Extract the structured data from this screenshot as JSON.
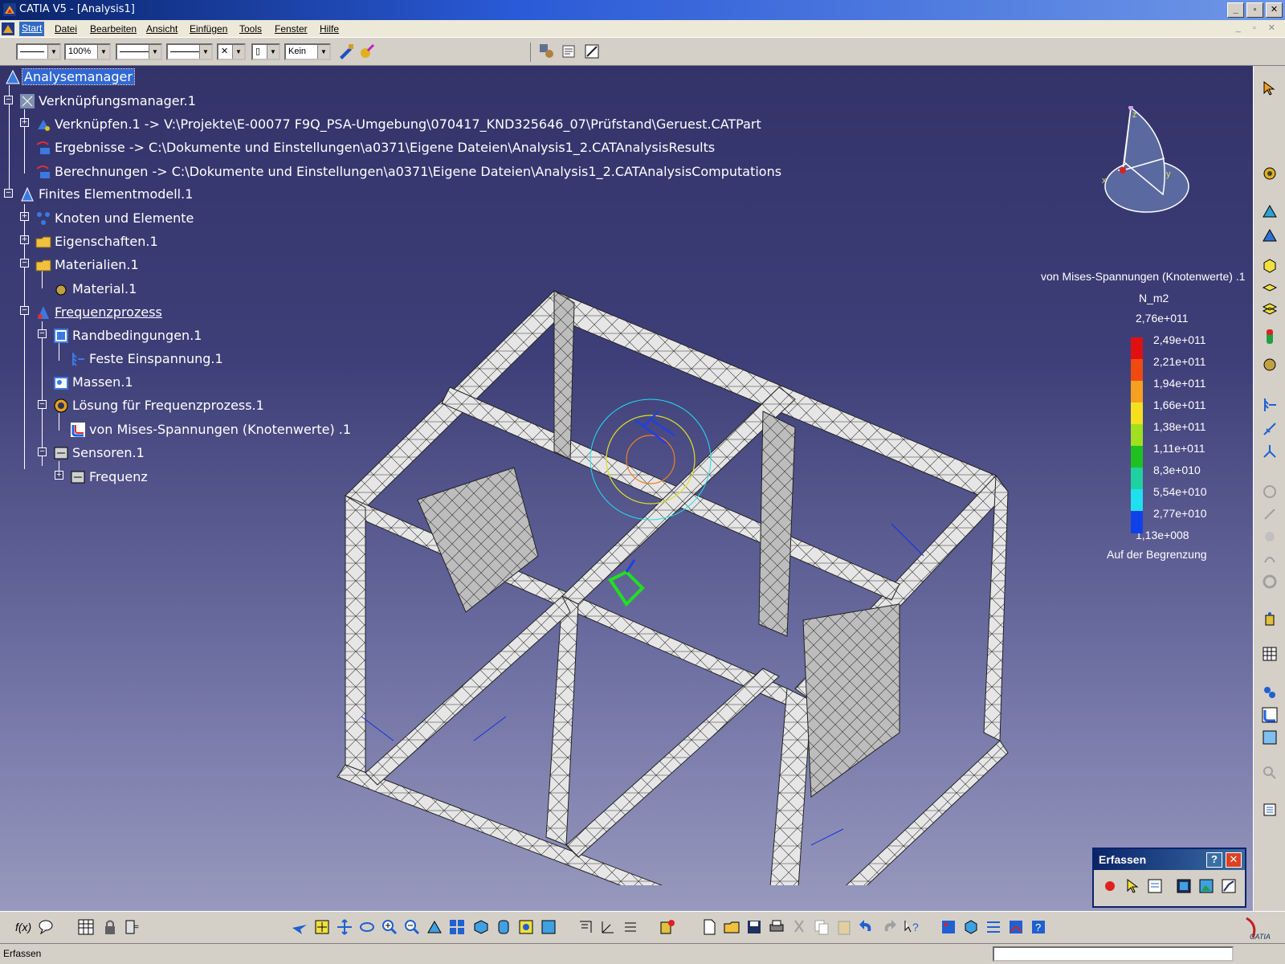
{
  "window": {
    "title": "CATIA V5 - [Analysis1]"
  },
  "menu": {
    "items": [
      "Start",
      "Datei",
      "Bearbeiten",
      "Ansicht",
      "Einfügen",
      "Tools",
      "Fenster",
      "Hilfe"
    ]
  },
  "toolbar_top": {
    "zoom_value": "100%",
    "layer_value": "Kein"
  },
  "tree": {
    "nodes": [
      {
        "label": "Analysemanager",
        "icon": "analysis-manager-icon"
      },
      {
        "label": "Verknüpfungsmanager.1",
        "icon": "links-manager-icon"
      },
      {
        "label": "Verknüpfen.1 -> V:\\Projekte\\E-00077 F9Q_PSA-Umgebung\\070417_KND325646_07\\Prüfstand\\Geruest.CATPart",
        "icon": "link-icon"
      },
      {
        "label": "Ergebnisse -> C:\\Dokumente und Einstellungen\\a0371\\Eigene Dateien\\Analysis1_2.CATAnalysisResults",
        "icon": "results-icon"
      },
      {
        "label": "Berechnungen -> C:\\Dokumente und Einstellungen\\a0371\\Eigene Dateien\\Analysis1_2.CATAnalysisComputations",
        "icon": "computations-icon"
      },
      {
        "label": "Finites Elementmodell.1",
        "icon": "fe-model-icon"
      },
      {
        "label": "Knoten und Elemente",
        "icon": "nodes-elements-icon"
      },
      {
        "label": "Eigenschaften.1",
        "icon": "folder-icon"
      },
      {
        "label": "Materialien.1",
        "icon": "folder-icon"
      },
      {
        "label": "Material.1",
        "icon": "material-icon"
      },
      {
        "label": "Frequenzprozess",
        "icon": "frequency-process-icon"
      },
      {
        "label": "Randbedingungen.1",
        "icon": "boundary-conditions-icon"
      },
      {
        "label": "Feste Einspannung.1",
        "icon": "clamp-icon"
      },
      {
        "label": "Massen.1",
        "icon": "masses-icon"
      },
      {
        "label": "Lösung für Frequenzprozess.1",
        "icon": "solution-icon"
      },
      {
        "label": "von Mises-Spannungen (Knotenwerte) .1",
        "icon": "von-mises-icon"
      },
      {
        "label": "Sensoren.1",
        "icon": "sensors-icon"
      },
      {
        "label": "Frequenz",
        "icon": "frequency-sensor-icon"
      }
    ]
  },
  "legend": {
    "title": "von Mises-Spannungen (Knotenwerte) .1",
    "unit": "N_m2",
    "values": [
      "2,76e+011",
      "2,49e+011",
      "2,21e+011",
      "1,94e+011",
      "1,66e+011",
      "1,38e+011",
      "1,11e+011",
      "8,3e+010",
      "5,54e+010",
      "2,77e+010",
      "1,13e+008"
    ],
    "colors": [
      "#e01010",
      "#f04a10",
      "#f5a020",
      "#f5e020",
      "#a0e020",
      "#20c020",
      "#20d0a0",
      "#20e0f0",
      "#1040e8"
    ],
    "footer": "Auf der Begrenzung"
  },
  "compass": {
    "labels": [
      "z",
      "x",
      "y"
    ]
  },
  "erfassen": {
    "title": "Erfassen"
  },
  "status": {
    "text": "Erfassen"
  }
}
